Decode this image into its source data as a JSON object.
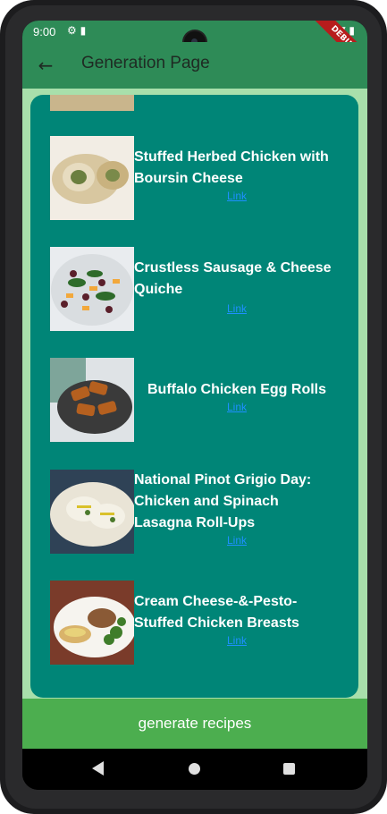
{
  "status_bar": {
    "time": "9:00",
    "left_icons": [
      "settings-icon",
      "sim-card-icon"
    ],
    "right_icons": [
      "wifi-icon",
      "battery-icon"
    ]
  },
  "debug_banner": "DEBUG",
  "appbar": {
    "back_icon": "arrow-back-icon",
    "title": "Generation Page"
  },
  "recipes": [
    {
      "title": "Stuffed Herbed Chicken with Boursin Cheese",
      "link_label": "Link"
    },
    {
      "title": "Crustless Sausage & Cheese Quiche",
      "link_label": "Link"
    },
    {
      "title": "Buffalo Chicken Egg Rolls",
      "link_label": "Link"
    },
    {
      "title": "National Pinot Grigio Day: Chicken and Spinach Lasagna Roll-Ups",
      "link_label": "Link"
    },
    {
      "title": "Cream Cheese-&-Pesto-Stuffed Chicken Breasts",
      "link_label": "Link"
    }
  ],
  "generate_button": {
    "label": "generate recipes"
  },
  "nav": {
    "back": "nav-back-icon",
    "home": "nav-home-icon",
    "recents": "nav-recents-icon"
  },
  "colors": {
    "appbar": "#2e8b57",
    "panel": "#008577",
    "background": "#a8dfab",
    "button": "#4cae4f",
    "link": "#1e90ff"
  }
}
